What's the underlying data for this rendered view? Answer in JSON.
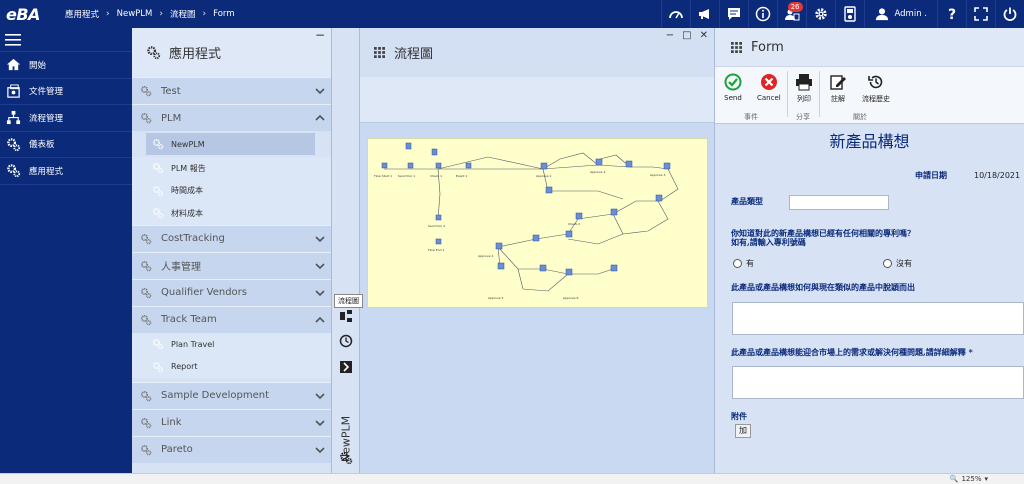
{
  "app": {
    "logo": "eBA"
  },
  "breadcrumb": [
    "應用程式",
    "NewPLM",
    "流程圖",
    "Form"
  ],
  "topbar": {
    "icons": [
      "dashboard-icon",
      "megaphone-icon",
      "message-icon",
      "info-icon",
      "tasks-icon",
      "settings-icon",
      "device-icon"
    ],
    "task_badge": "26",
    "user_name": "Admin .",
    "right_icons": [
      "help-icon",
      "fullscreen-icon",
      "power-icon"
    ]
  },
  "leftnav": {
    "items": [
      {
        "label": "開始",
        "icon": "home-icon"
      },
      {
        "label": "文件管理",
        "icon": "document-management-icon"
      },
      {
        "label": "流程管理",
        "icon": "workflow-icon"
      },
      {
        "label": "儀表板",
        "icon": "dashboard-gear-icon"
      },
      {
        "label": "應用程式",
        "icon": "applications-icon"
      }
    ]
  },
  "apps": {
    "title": "應用程式",
    "minimize": "−",
    "groups": [
      {
        "label": "Test",
        "expanded": false
      },
      {
        "label": "PLM",
        "expanded": true,
        "items": [
          "NewPLM",
          "PLM 報告",
          "時間成本",
          "材料成本"
        ],
        "selected": "NewPLM"
      },
      {
        "label": "CostTracking",
        "expanded": false
      },
      {
        "label": "人事管理",
        "expanded": false
      },
      {
        "label": "Qualifier Vendors",
        "expanded": false
      },
      {
        "label": "Track Team",
        "expanded": true,
        "items": [
          "Plan Travel",
          "Report"
        ]
      },
      {
        "label": "Sample Development",
        "expanded": false
      },
      {
        "label": "Link",
        "expanded": false
      },
      {
        "label": "Pareto",
        "expanded": false
      }
    ]
  },
  "vstrip": {
    "label": "NewPLM",
    "tooltip": "流程圖"
  },
  "flow": {
    "title": "流程圖",
    "controls": [
      "−",
      "□",
      "✕"
    ]
  },
  "form": {
    "title": "Form",
    "ribbon": {
      "send": "Send",
      "cancel": "Cancel",
      "print": "列印",
      "comment": "註解",
      "history": "流程歷史",
      "group_event": "事件",
      "group_share": "分享",
      "group_related": "關於"
    },
    "doc_title": "新產品構想",
    "date_label": "申請日期",
    "date_value": "10/18/2021",
    "product_type_label": "產品類型",
    "product_type_value": "",
    "patent_question": "你知道對此的新產品構想已經有任何相關的專利嗎？",
    "patent_hint": "如有,請輸入專利號碼",
    "radio_yes": "有",
    "radio_no": "沒有",
    "diff_question": "此產品或產品構想如何與現在類似的產品中脫穎而出",
    "market_question": "此產品或產品構想能迎合市場上的需求或解決何種問題,請詳細解釋 *",
    "attachment_label": "附件",
    "add_button": "加"
  },
  "statusbar": {
    "zoom": "125%"
  }
}
